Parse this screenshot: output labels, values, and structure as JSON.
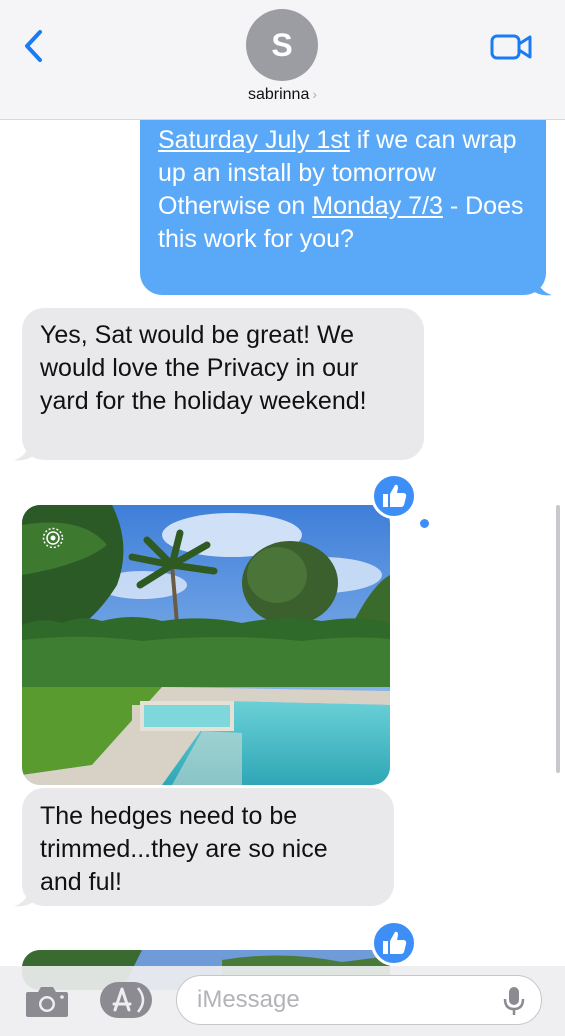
{
  "header": {
    "avatar_initial": "S",
    "contact_name": "sabrinna",
    "chevron": "›",
    "back_icon": "chevron-left-icon",
    "video_icon": "video-camera-icon"
  },
  "messages": [
    {
      "direction": "sent",
      "segments": [
        {
          "text": "Saturday July 1st",
          "link": true
        },
        {
          "text": " if we can wrap up an install by tomorrow Otherwise on ",
          "link": false
        },
        {
          "text": "Monday 7/3",
          "link": true
        },
        {
          "text": " - Does this work for you?",
          "link": false
        }
      ]
    },
    {
      "direction": "received",
      "text": "Yes, Sat would be great! We would love the Privacy in our yard for the holiday weekend!"
    },
    {
      "direction": "received",
      "type": "photo",
      "subject": "backyard pool with palm trees and hedges",
      "live_photo_icon": "live-photo-icon",
      "tapback": "thumbs-up-icon"
    },
    {
      "direction": "received",
      "text": "The hedges need to be trimmed...they are so nice and ful!"
    },
    {
      "direction": "received",
      "type": "photo",
      "partial": true,
      "tapback": "thumbs-up-icon"
    }
  ],
  "input": {
    "placeholder": "iMessage",
    "camera_icon": "camera-icon",
    "apps_icon": "app-store-icon",
    "mic_icon": "microphone-icon"
  },
  "colors": {
    "sent_bubble": "#5aa9f8",
    "received_bubble": "#e9e9eb",
    "accent": "#3d8ff7"
  }
}
